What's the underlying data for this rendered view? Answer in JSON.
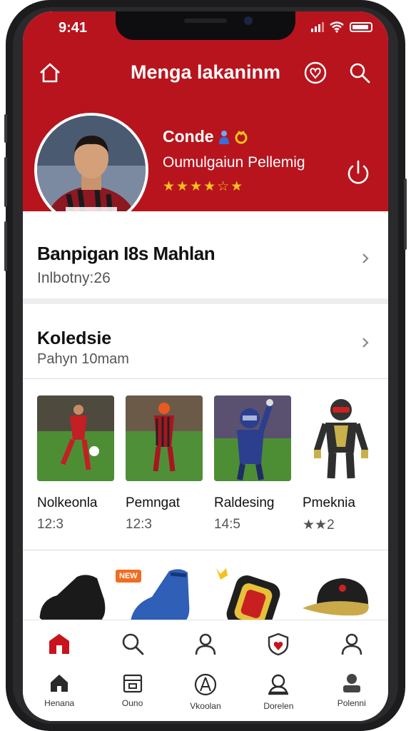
{
  "status_bar": {
    "time": "9:41"
  },
  "header": {
    "title": "Menga lakaninm"
  },
  "profile": {
    "name": "Conde",
    "subtitle": "Oumulgaiun Pellemig",
    "rating": 3.5,
    "stars_text": "★★★★☆★"
  },
  "summary_card": {
    "title": "Banpigan I8s Mahlan",
    "subtitle": "Inlbotny:26"
  },
  "collection": {
    "title": "Koledsie",
    "subtitle": "Pahyn 10mam",
    "items": [
      {
        "name": "Nolkeonla",
        "meta": "12:3"
      },
      {
        "name": "Pemngat",
        "meta": "12:3"
      },
      {
        "name": "Raldesing",
        "meta": "14:5"
      },
      {
        "name": "Pmeknia",
        "meta": "★★2"
      }
    ]
  },
  "products": {
    "badge": "NEW",
    "items": [
      "boot-black",
      "boot-blue",
      "phone-case",
      "cap"
    ]
  },
  "tabs_top": [
    "home",
    "search",
    "profile",
    "shield",
    "account"
  ],
  "tabs_bottom": [
    {
      "label": "Henana"
    },
    {
      "label": "Ouno"
    },
    {
      "label": "Vkoolan"
    },
    {
      "label": "Dorelen"
    },
    {
      "label": "Polenni"
    }
  ],
  "colors": {
    "brand_red": "#b8141d",
    "star_gold": "#f6c21a",
    "badge_orange": "#f06d20"
  }
}
